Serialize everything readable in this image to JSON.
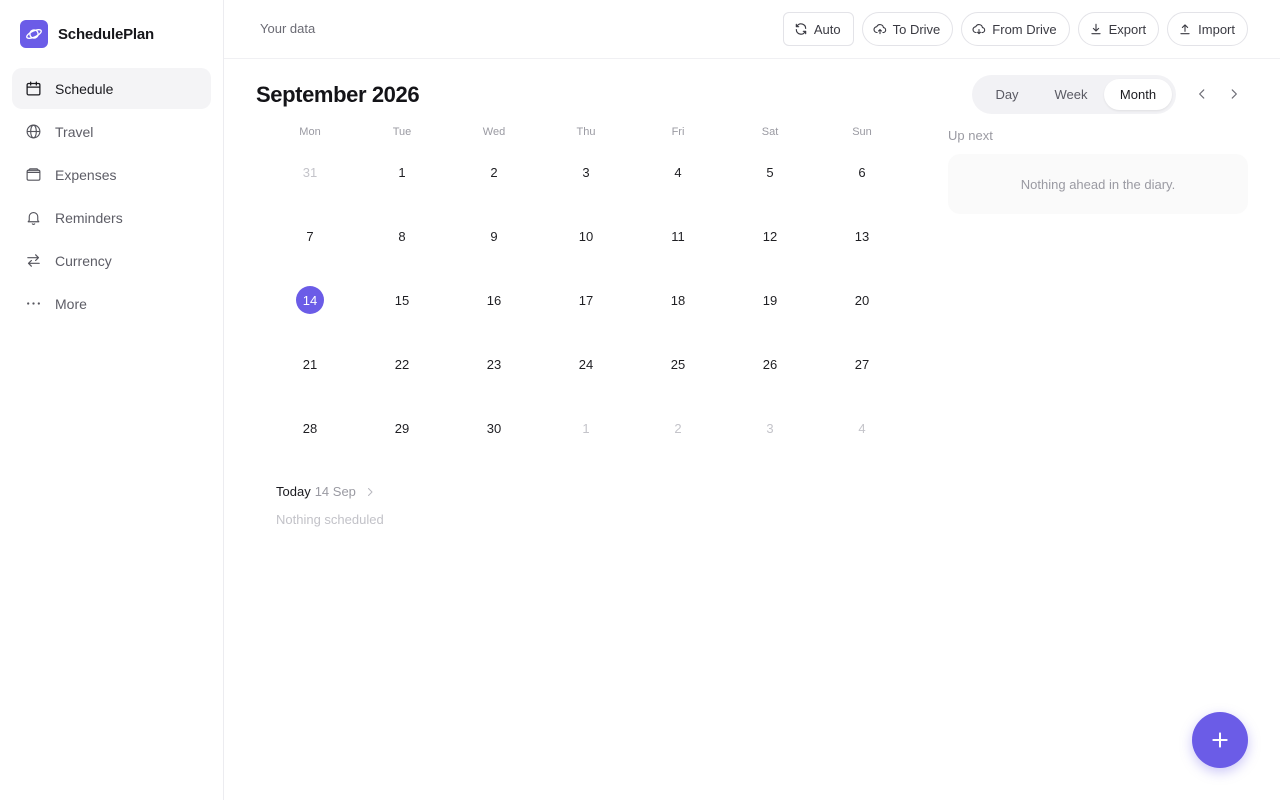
{
  "app": {
    "name": "SchedulePlan",
    "accent_color": "#6b5ce7"
  },
  "sidebar": {
    "items": [
      {
        "label": "Schedule",
        "icon": "calendar-icon",
        "active": true
      },
      {
        "label": "Travel",
        "icon": "globe-icon",
        "active": false
      },
      {
        "label": "Expenses",
        "icon": "wallet-icon",
        "active": false
      },
      {
        "label": "Reminders",
        "icon": "bell-icon",
        "active": false
      },
      {
        "label": "Currency",
        "icon": "swap-icon",
        "active": false
      },
      {
        "label": "More",
        "icon": "more-dots-icon",
        "active": false
      }
    ]
  },
  "topbar": {
    "label": "Your data",
    "actions": {
      "auto": "Auto",
      "to_drive": "To Drive",
      "from_drive": "From Drive",
      "export": "Export",
      "import": "Import"
    }
  },
  "calendar": {
    "title": "September 2026",
    "views": {
      "day": "Day",
      "week": "Week",
      "month": "Month",
      "selected": "Month"
    },
    "weekdays": [
      "Mon",
      "Tue",
      "Wed",
      "Thu",
      "Fri",
      "Sat",
      "Sun"
    ],
    "weeks": [
      [
        {
          "d": "31",
          "muted": true
        },
        {
          "d": "1"
        },
        {
          "d": "2"
        },
        {
          "d": "3"
        },
        {
          "d": "4"
        },
        {
          "d": "5"
        },
        {
          "d": "6"
        }
      ],
      [
        {
          "d": "7"
        },
        {
          "d": "8"
        },
        {
          "d": "9"
        },
        {
          "d": "10"
        },
        {
          "d": "11"
        },
        {
          "d": "12"
        },
        {
          "d": "13"
        }
      ],
      [
        {
          "d": "14",
          "today": true
        },
        {
          "d": "15"
        },
        {
          "d": "16"
        },
        {
          "d": "17"
        },
        {
          "d": "18"
        },
        {
          "d": "19"
        },
        {
          "d": "20"
        }
      ],
      [
        {
          "d": "21"
        },
        {
          "d": "22"
        },
        {
          "d": "23"
        },
        {
          "d": "24"
        },
        {
          "d": "25"
        },
        {
          "d": "26"
        },
        {
          "d": "27"
        }
      ],
      [
        {
          "d": "28"
        },
        {
          "d": "29"
        },
        {
          "d": "30"
        },
        {
          "d": "1",
          "muted": true
        },
        {
          "d": "2",
          "muted": true
        },
        {
          "d": "3",
          "muted": true
        },
        {
          "d": "4",
          "muted": true
        }
      ]
    ]
  },
  "today": {
    "label": "Today",
    "date": "14 Sep",
    "empty_text": "Nothing scheduled"
  },
  "upnext": {
    "label": "Up next",
    "empty_text": "Nothing ahead in the diary."
  }
}
